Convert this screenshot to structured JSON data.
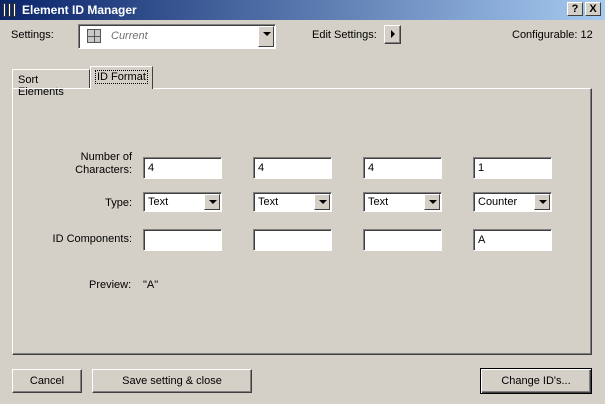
{
  "window": {
    "title": "Element ID Manager",
    "help_glyph": "?",
    "close_glyph": "X"
  },
  "settings": {
    "label": "Settings:",
    "value": "Current",
    "edit_label": "Edit Settings:",
    "configurable": "Configurable: 12"
  },
  "tabs": [
    {
      "label": "Sort Elements",
      "active": false
    },
    {
      "label": "ID Format",
      "active": true
    }
  ],
  "format": {
    "chars_label_line1": "Number of",
    "chars_label_line2": "Characters:",
    "type_label": "Type:",
    "components_label": "ID Components:",
    "preview_label": "Preview:",
    "preview_value": "\"A\"",
    "columns": [
      {
        "chars": "4",
        "type": "Text",
        "component": ""
      },
      {
        "chars": "4",
        "type": "Text",
        "component": ""
      },
      {
        "chars": "4",
        "type": "Text",
        "component": ""
      },
      {
        "chars": "1",
        "type": "Counter",
        "component": "A"
      }
    ]
  },
  "buttons": {
    "cancel": "Cancel",
    "save_close": "Save setting & close",
    "change_ids": "Change ID's..."
  },
  "icons": {
    "app": "bookshelf-icon",
    "settings_item": "grid-icon",
    "edit_arrow": "triangle-right-icon"
  }
}
